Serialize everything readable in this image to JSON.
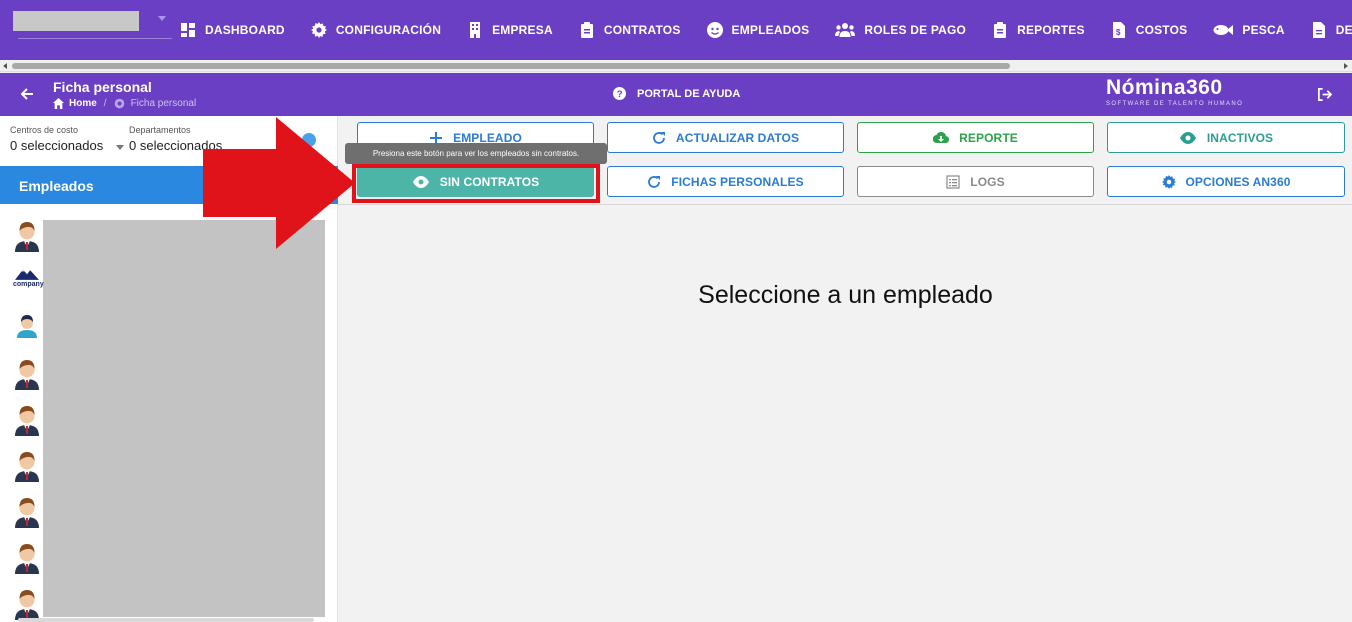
{
  "nav": {
    "items": [
      {
        "label": "DASHBOARD",
        "icon": "dashboard-icon"
      },
      {
        "label": "CONFIGURACIÓN",
        "icon": "gear-icon"
      },
      {
        "label": "EMPRESA",
        "icon": "building-icon"
      },
      {
        "label": "CONTRATOS",
        "icon": "clipboard-icon"
      },
      {
        "label": "EMPLEADOS",
        "icon": "face-icon"
      },
      {
        "label": "ROLES DE PAGO",
        "icon": "people-icon"
      },
      {
        "label": "REPORTES",
        "icon": "clipboard-icon"
      },
      {
        "label": "COSTOS",
        "icon": "invoice-icon"
      },
      {
        "label": "PESCA",
        "icon": "fish-icon"
      },
      {
        "label": "DESTAJO",
        "icon": "document-icon"
      }
    ]
  },
  "header": {
    "title": "Ficha personal",
    "breadcrumb_home": "Home",
    "breadcrumb_sep": "/",
    "breadcrumb_current": "Ficha personal",
    "help_label": "PORTAL DE AYUDA",
    "logo_main": "Nómina360",
    "logo_sub": "SOFTWARE DE TALENTO HUMANO"
  },
  "filters": {
    "cost_centers_label": "Centros de costo",
    "cost_centers_value": "0 seleccionados",
    "departments_label": "Departamentos",
    "departments_value": "0 seleccionados"
  },
  "employees": {
    "header": "Empleados",
    "company_logo_text": "company"
  },
  "actions": {
    "empleado": "EMPLEADO",
    "actualizar": "ACTUALIZAR DATOS",
    "reporte": "REPORTE",
    "inactivos": "INACTIVOS",
    "sin_contratos": "SIN CONTRATOS",
    "fichas": "FICHAS PERSONALES",
    "logs": "LOGS",
    "opciones": "OPCIONES AN360"
  },
  "tooltip": "Presiona este botón para ver los empleados sin contratos.",
  "main_message": "Seleccione a un empleado",
  "colors": {
    "nav_bg": "#6a3fc4",
    "header_blue": "#2a88e0",
    "highlight_red": "#e0131b",
    "teal_button": "#4cb5a7"
  }
}
